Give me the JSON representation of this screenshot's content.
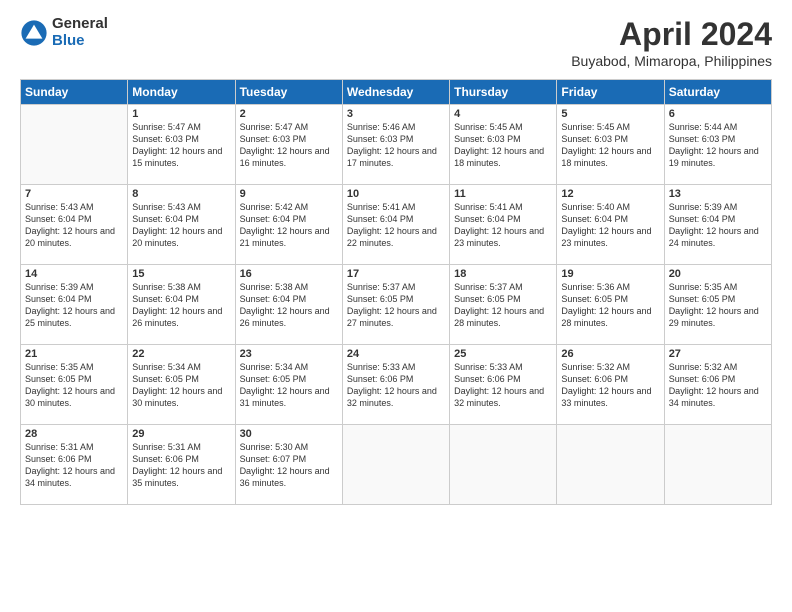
{
  "logo": {
    "general": "General",
    "blue": "Blue"
  },
  "title": "April 2024",
  "location": "Buyabod, Mimaropa, Philippines",
  "headers": [
    "Sunday",
    "Monday",
    "Tuesday",
    "Wednesday",
    "Thursday",
    "Friday",
    "Saturday"
  ],
  "weeks": [
    [
      {
        "day": "",
        "sunrise": "",
        "sunset": "",
        "daylight": ""
      },
      {
        "day": "1",
        "sunrise": "Sunrise: 5:47 AM",
        "sunset": "Sunset: 6:03 PM",
        "daylight": "Daylight: 12 hours and 15 minutes."
      },
      {
        "day": "2",
        "sunrise": "Sunrise: 5:47 AM",
        "sunset": "Sunset: 6:03 PM",
        "daylight": "Daylight: 12 hours and 16 minutes."
      },
      {
        "day": "3",
        "sunrise": "Sunrise: 5:46 AM",
        "sunset": "Sunset: 6:03 PM",
        "daylight": "Daylight: 12 hours and 17 minutes."
      },
      {
        "day": "4",
        "sunrise": "Sunrise: 5:45 AM",
        "sunset": "Sunset: 6:03 PM",
        "daylight": "Daylight: 12 hours and 18 minutes."
      },
      {
        "day": "5",
        "sunrise": "Sunrise: 5:45 AM",
        "sunset": "Sunset: 6:03 PM",
        "daylight": "Daylight: 12 hours and 18 minutes."
      },
      {
        "day": "6",
        "sunrise": "Sunrise: 5:44 AM",
        "sunset": "Sunset: 6:03 PM",
        "daylight": "Daylight: 12 hours and 19 minutes."
      }
    ],
    [
      {
        "day": "7",
        "sunrise": "Sunrise: 5:43 AM",
        "sunset": "Sunset: 6:04 PM",
        "daylight": "Daylight: 12 hours and 20 minutes."
      },
      {
        "day": "8",
        "sunrise": "Sunrise: 5:43 AM",
        "sunset": "Sunset: 6:04 PM",
        "daylight": "Daylight: 12 hours and 20 minutes."
      },
      {
        "day": "9",
        "sunrise": "Sunrise: 5:42 AM",
        "sunset": "Sunset: 6:04 PM",
        "daylight": "Daylight: 12 hours and 21 minutes."
      },
      {
        "day": "10",
        "sunrise": "Sunrise: 5:41 AM",
        "sunset": "Sunset: 6:04 PM",
        "daylight": "Daylight: 12 hours and 22 minutes."
      },
      {
        "day": "11",
        "sunrise": "Sunrise: 5:41 AM",
        "sunset": "Sunset: 6:04 PM",
        "daylight": "Daylight: 12 hours and 23 minutes."
      },
      {
        "day": "12",
        "sunrise": "Sunrise: 5:40 AM",
        "sunset": "Sunset: 6:04 PM",
        "daylight": "Daylight: 12 hours and 23 minutes."
      },
      {
        "day": "13",
        "sunrise": "Sunrise: 5:39 AM",
        "sunset": "Sunset: 6:04 PM",
        "daylight": "Daylight: 12 hours and 24 minutes."
      }
    ],
    [
      {
        "day": "14",
        "sunrise": "Sunrise: 5:39 AM",
        "sunset": "Sunset: 6:04 PM",
        "daylight": "Daylight: 12 hours and 25 minutes."
      },
      {
        "day": "15",
        "sunrise": "Sunrise: 5:38 AM",
        "sunset": "Sunset: 6:04 PM",
        "daylight": "Daylight: 12 hours and 26 minutes."
      },
      {
        "day": "16",
        "sunrise": "Sunrise: 5:38 AM",
        "sunset": "Sunset: 6:04 PM",
        "daylight": "Daylight: 12 hours and 26 minutes."
      },
      {
        "day": "17",
        "sunrise": "Sunrise: 5:37 AM",
        "sunset": "Sunset: 6:05 PM",
        "daylight": "Daylight: 12 hours and 27 minutes."
      },
      {
        "day": "18",
        "sunrise": "Sunrise: 5:37 AM",
        "sunset": "Sunset: 6:05 PM",
        "daylight": "Daylight: 12 hours and 28 minutes."
      },
      {
        "day": "19",
        "sunrise": "Sunrise: 5:36 AM",
        "sunset": "Sunset: 6:05 PM",
        "daylight": "Daylight: 12 hours and 28 minutes."
      },
      {
        "day": "20",
        "sunrise": "Sunrise: 5:35 AM",
        "sunset": "Sunset: 6:05 PM",
        "daylight": "Daylight: 12 hours and 29 minutes."
      }
    ],
    [
      {
        "day": "21",
        "sunrise": "Sunrise: 5:35 AM",
        "sunset": "Sunset: 6:05 PM",
        "daylight": "Daylight: 12 hours and 30 minutes."
      },
      {
        "day": "22",
        "sunrise": "Sunrise: 5:34 AM",
        "sunset": "Sunset: 6:05 PM",
        "daylight": "Daylight: 12 hours and 30 minutes."
      },
      {
        "day": "23",
        "sunrise": "Sunrise: 5:34 AM",
        "sunset": "Sunset: 6:05 PM",
        "daylight": "Daylight: 12 hours and 31 minutes."
      },
      {
        "day": "24",
        "sunrise": "Sunrise: 5:33 AM",
        "sunset": "Sunset: 6:06 PM",
        "daylight": "Daylight: 12 hours and 32 minutes."
      },
      {
        "day": "25",
        "sunrise": "Sunrise: 5:33 AM",
        "sunset": "Sunset: 6:06 PM",
        "daylight": "Daylight: 12 hours and 32 minutes."
      },
      {
        "day": "26",
        "sunrise": "Sunrise: 5:32 AM",
        "sunset": "Sunset: 6:06 PM",
        "daylight": "Daylight: 12 hours and 33 minutes."
      },
      {
        "day": "27",
        "sunrise": "Sunrise: 5:32 AM",
        "sunset": "Sunset: 6:06 PM",
        "daylight": "Daylight: 12 hours and 34 minutes."
      }
    ],
    [
      {
        "day": "28",
        "sunrise": "Sunrise: 5:31 AM",
        "sunset": "Sunset: 6:06 PM",
        "daylight": "Daylight: 12 hours and 34 minutes."
      },
      {
        "day": "29",
        "sunrise": "Sunrise: 5:31 AM",
        "sunset": "Sunset: 6:06 PM",
        "daylight": "Daylight: 12 hours and 35 minutes."
      },
      {
        "day": "30",
        "sunrise": "Sunrise: 5:30 AM",
        "sunset": "Sunset: 6:07 PM",
        "daylight": "Daylight: 12 hours and 36 minutes."
      },
      {
        "day": "",
        "sunrise": "",
        "sunset": "",
        "daylight": ""
      },
      {
        "day": "",
        "sunrise": "",
        "sunset": "",
        "daylight": ""
      },
      {
        "day": "",
        "sunrise": "",
        "sunset": "",
        "daylight": ""
      },
      {
        "day": "",
        "sunrise": "",
        "sunset": "",
        "daylight": ""
      }
    ]
  ]
}
